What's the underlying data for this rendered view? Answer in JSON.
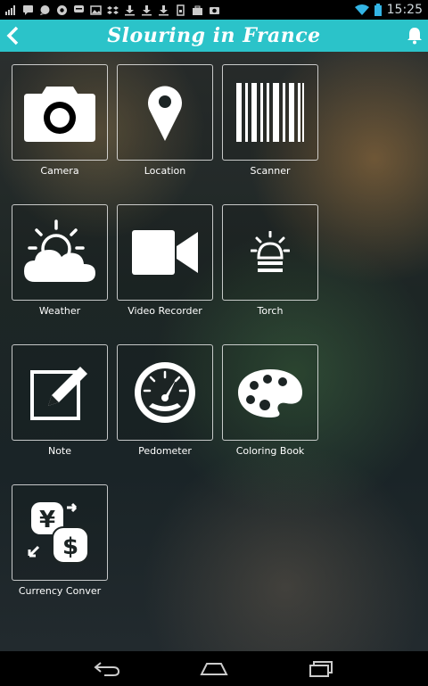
{
  "status_bar": {
    "time": "15:25",
    "icons": [
      "signal-bars-icon",
      "chat-icon",
      "chat-icon",
      "chrome-icon",
      "chat-icon",
      "image-icon",
      "dropbox-icon",
      "download-icon",
      "download-icon",
      "download-icon",
      "sim-icon",
      "briefcase-icon",
      "camera-icon",
      "wifi-icon",
      "battery-icon"
    ]
  },
  "header": {
    "title": "Slouring in France",
    "background": "#2bc3c9"
  },
  "tiles": [
    {
      "label": "Camera",
      "icon": "camera-icon"
    },
    {
      "label": "Location",
      "icon": "location-pin-icon"
    },
    {
      "label": "Scanner",
      "icon": "barcode-icon"
    },
    {
      "label": "Weather",
      "icon": "weather-icon"
    },
    {
      "label": "Video Recorder",
      "icon": "video-camera-icon"
    },
    {
      "label": "Torch",
      "icon": "torch-icon"
    },
    {
      "label": "Note",
      "icon": "note-edit-icon"
    },
    {
      "label": "Pedometer",
      "icon": "speedometer-icon"
    },
    {
      "label": "Coloring Book",
      "icon": "palette-icon"
    },
    {
      "label": "Currency Conver",
      "icon": "currency-icon"
    }
  ],
  "navigation": {
    "buttons": [
      "back-icon",
      "home-icon",
      "recent-apps-icon"
    ]
  }
}
